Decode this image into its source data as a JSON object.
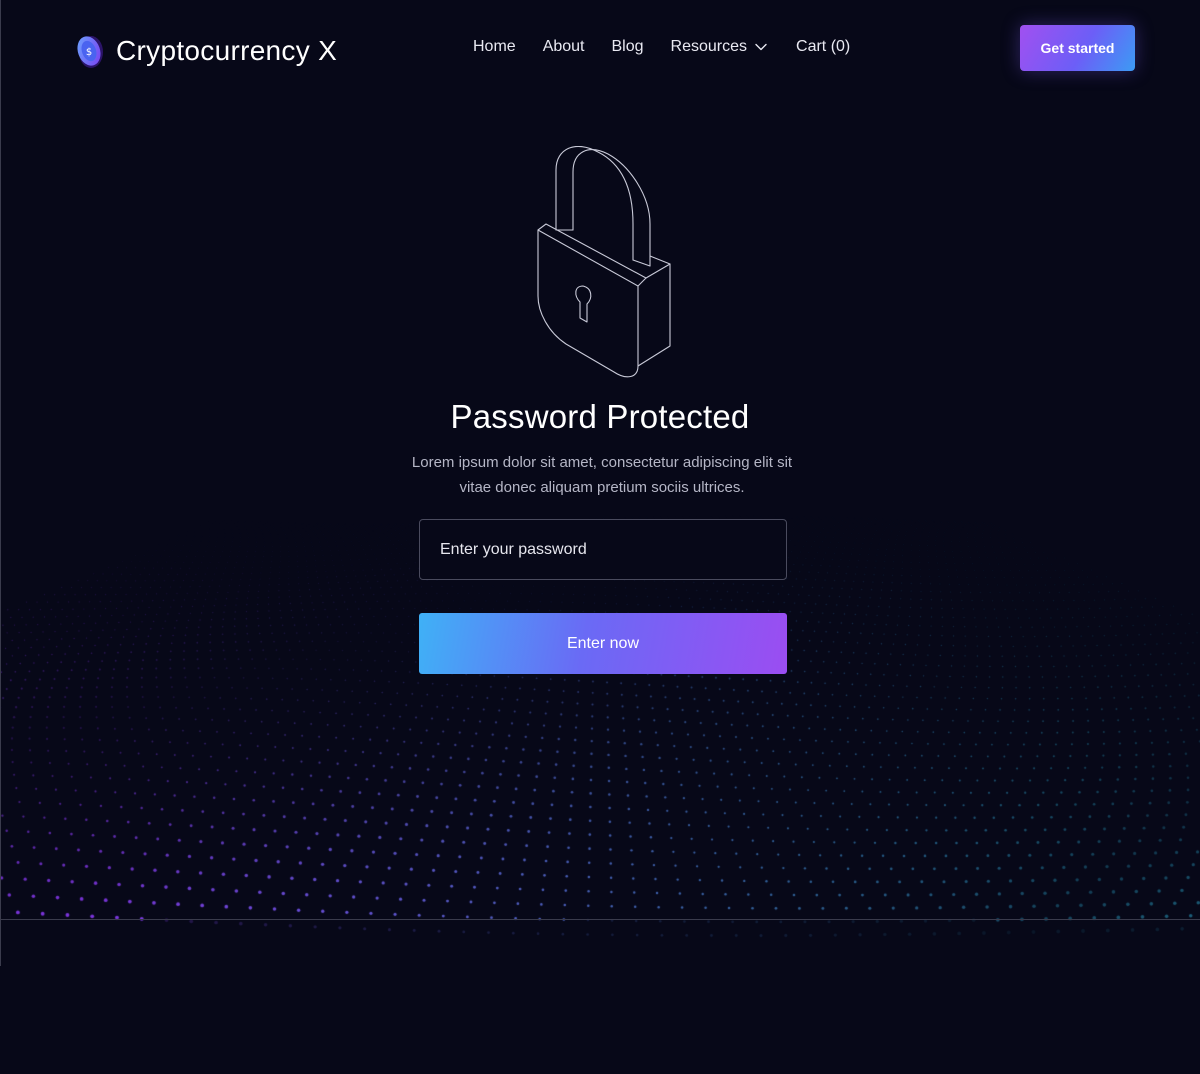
{
  "header": {
    "brand_name": "Cryptocurrency X",
    "logo_icon": "coin-dollar-icon",
    "nav": {
      "home": "Home",
      "about": "About",
      "blog": "Blog",
      "resources": "Resources",
      "cart": "Cart (0)"
    },
    "cta_label": "Get started"
  },
  "main": {
    "icon": "padlock-icon",
    "title": "Password Protected",
    "description": "Lorem ipsum dolor sit amet, consectetur adipiscing elit sit vitae donec aliquam pretium sociis ultrices.",
    "password_placeholder": "Enter your password",
    "submit_label": "Enter now"
  },
  "colors": {
    "background": "#070818",
    "accent_purple": "#9b4df2",
    "accent_blue": "#3fb1f6",
    "text_muted": "#b5b6c6"
  }
}
